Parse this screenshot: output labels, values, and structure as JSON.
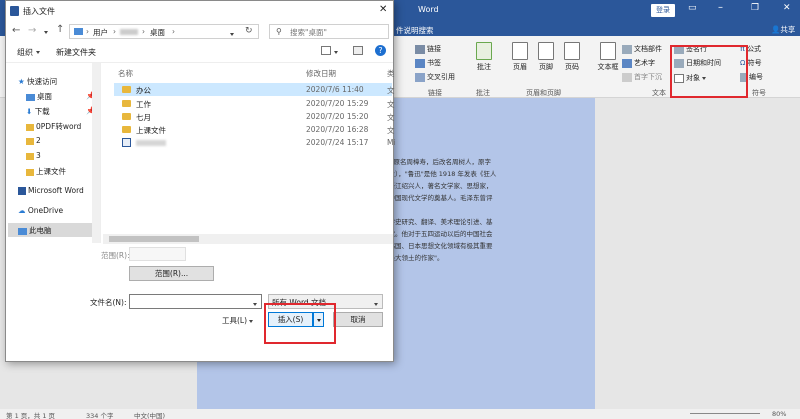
{
  "word": {
    "title": "Word",
    "tab_partial": "件说明搜索",
    "login": "登录",
    "share": "共享",
    "ribbon": {
      "link_group": {
        "items": [
          "链接",
          "书签",
          "交叉引用"
        ],
        "label": "链接"
      },
      "comment": {
        "button": "批注",
        "label": "批注"
      },
      "header_footer": {
        "items": [
          "页眉",
          "页脚",
          "页码"
        ],
        "label": "页眉和页脚"
      },
      "text": {
        "text_box": "文本框",
        "parts": "文档部件",
        "art": "艺术字",
        "dropcap": "首字下沉",
        "signature": "签名行",
        "datetime": "日期和时间",
        "object": "对象",
        "label": "文本"
      },
      "symbols": {
        "equation": "公式",
        "symbol": "符号",
        "numbering": "编号",
        "label": "符号"
      }
    },
    "doc_lines": [
      "19日），原名周樟寿，后改名周树人，原字",
      "校（肄业），\"鲁迅\"是他 1918 年发表《狂人",
      "笔名。浙江绍兴人，著名文学家、思想家，",
      "与者，中国现代文学的奠基人。毛泽东曾评",
      "",
      "究、文学史研究、翻译、美术理论引进、基",
      "重大贡献。他对于五四运动以后的中国社会",
      "尤其在韩国、日本思想文化领域有极其重要",
      "史上占最大领土的作家\"。"
    ],
    "status": {
      "page": "第 1 页，共 1 页",
      "words": "334 个字",
      "lang": "中文(中国)",
      "zoom": "80%"
    }
  },
  "dialog": {
    "title": "插入文件",
    "breadcrumb": [
      "用户",
      "桌面"
    ],
    "search_placeholder": "搜索\"桌面\"",
    "organize": "组织",
    "new_folder": "新建文件夹",
    "nav": {
      "quick_access": "快速访问",
      "items": [
        "桌面",
        "下载",
        "0PDF转word",
        "2",
        "3",
        "上课文件"
      ],
      "word": "Microsoft Word",
      "onedrive": "OneDrive",
      "this_pc": "此电脑"
    },
    "columns": {
      "name": "名称",
      "date": "修改日期",
      "type": "类"
    },
    "files": [
      {
        "name": "办公",
        "date": "2020/7/6 11:40",
        "type": "文"
      },
      {
        "name": "工作",
        "date": "2020/7/20 15:29",
        "type": "文"
      },
      {
        "name": "七月",
        "date": "2020/7/20 15:20",
        "type": "文"
      },
      {
        "name": "上课文件",
        "date": "2020/7/20 16:28",
        "type": "文"
      },
      {
        "name": "",
        "date": "2020/7/24 15:17",
        "type": "Mi"
      }
    ],
    "range_label": "范围(R):",
    "range_button": "范围(R)...",
    "filename_label": "文件名(N):",
    "filename_value": "",
    "filetype": "所有 Word 文档",
    "tools": "工具(L)",
    "insert": "插入(S)",
    "cancel": "取消"
  },
  "colors": {
    "word_blue": "#2b579a",
    "highlight_red": "#e0282e",
    "selected_row": "#cce8ff",
    "page_blue": "#b3c5e8"
  }
}
